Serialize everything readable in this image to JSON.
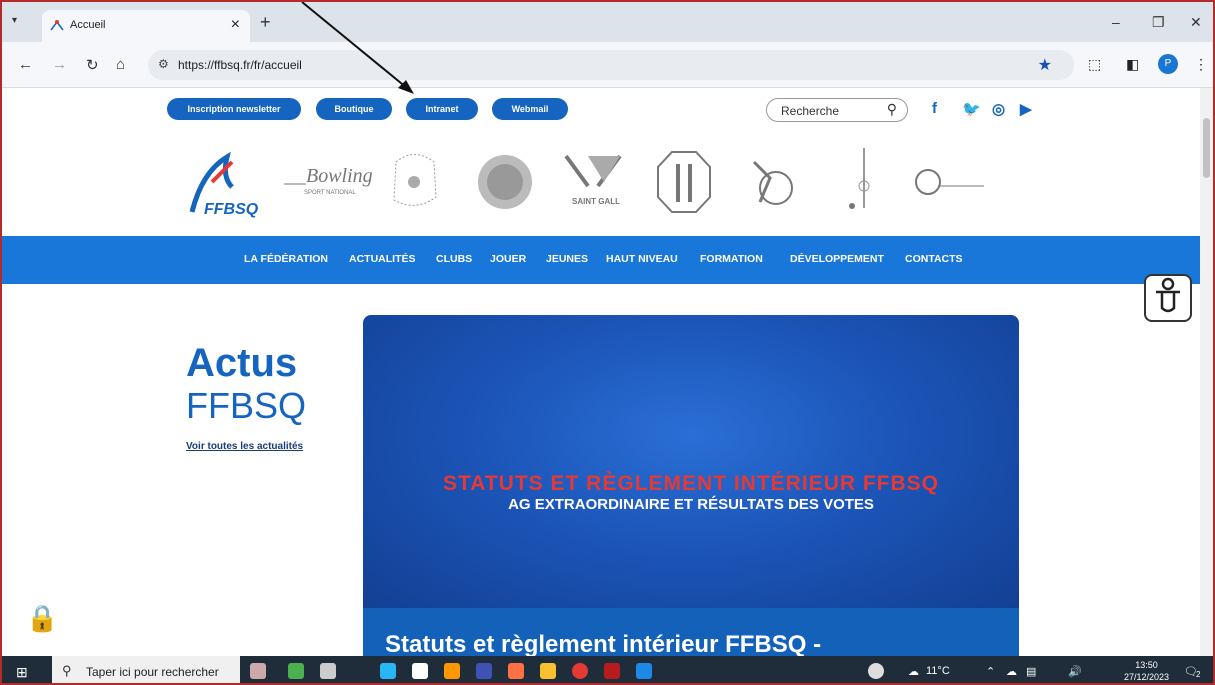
{
  "browser": {
    "tab_title": "Accueil",
    "new_tab": "+",
    "url": "https://ffbsq.fr/fr/accueil",
    "avatar_initial": "P"
  },
  "topbar": {
    "buttons": [
      "Inscription newsletter",
      "Boutique",
      "Intranet",
      "Webmail"
    ],
    "search_placeholder": "Recherche"
  },
  "menu": [
    "LA FÉDÉRATION",
    "ACTUALITÉS",
    "CLUBS",
    "JOUER",
    "JEUNES",
    "HAUT NIVEAU",
    "FORMATION",
    "DÉVELOPPEMENT",
    "CONTACTS"
  ],
  "logos": {
    "main": "FFBSQ",
    "bowling": "Bowling",
    "bowling_sub": "SPORT NATIONAL",
    "saint_gall": "SAINT GALL"
  },
  "actus": {
    "line1": "Actus",
    "line2": "FFBSQ",
    "link": "Voir toutes les actualités"
  },
  "banner": {
    "headline": "STATUTS ET RÈGLEMENT INTÉRIEUR FFBSQ",
    "subline": "AG EXTRAORDINAIRE ET RÉSULTATS DES VOTES",
    "caption": "Statuts et règlement intérieur FFBSQ -"
  },
  "taskbar": {
    "search_placeholder": "Taper ici pour rechercher",
    "temperature": "11°C",
    "time": "13:50",
    "date": "27/12/2023",
    "notifications": "2"
  },
  "colors": {
    "accent": "#1565c0",
    "menu": "#1877d8",
    "headline_red": "#e53935"
  }
}
